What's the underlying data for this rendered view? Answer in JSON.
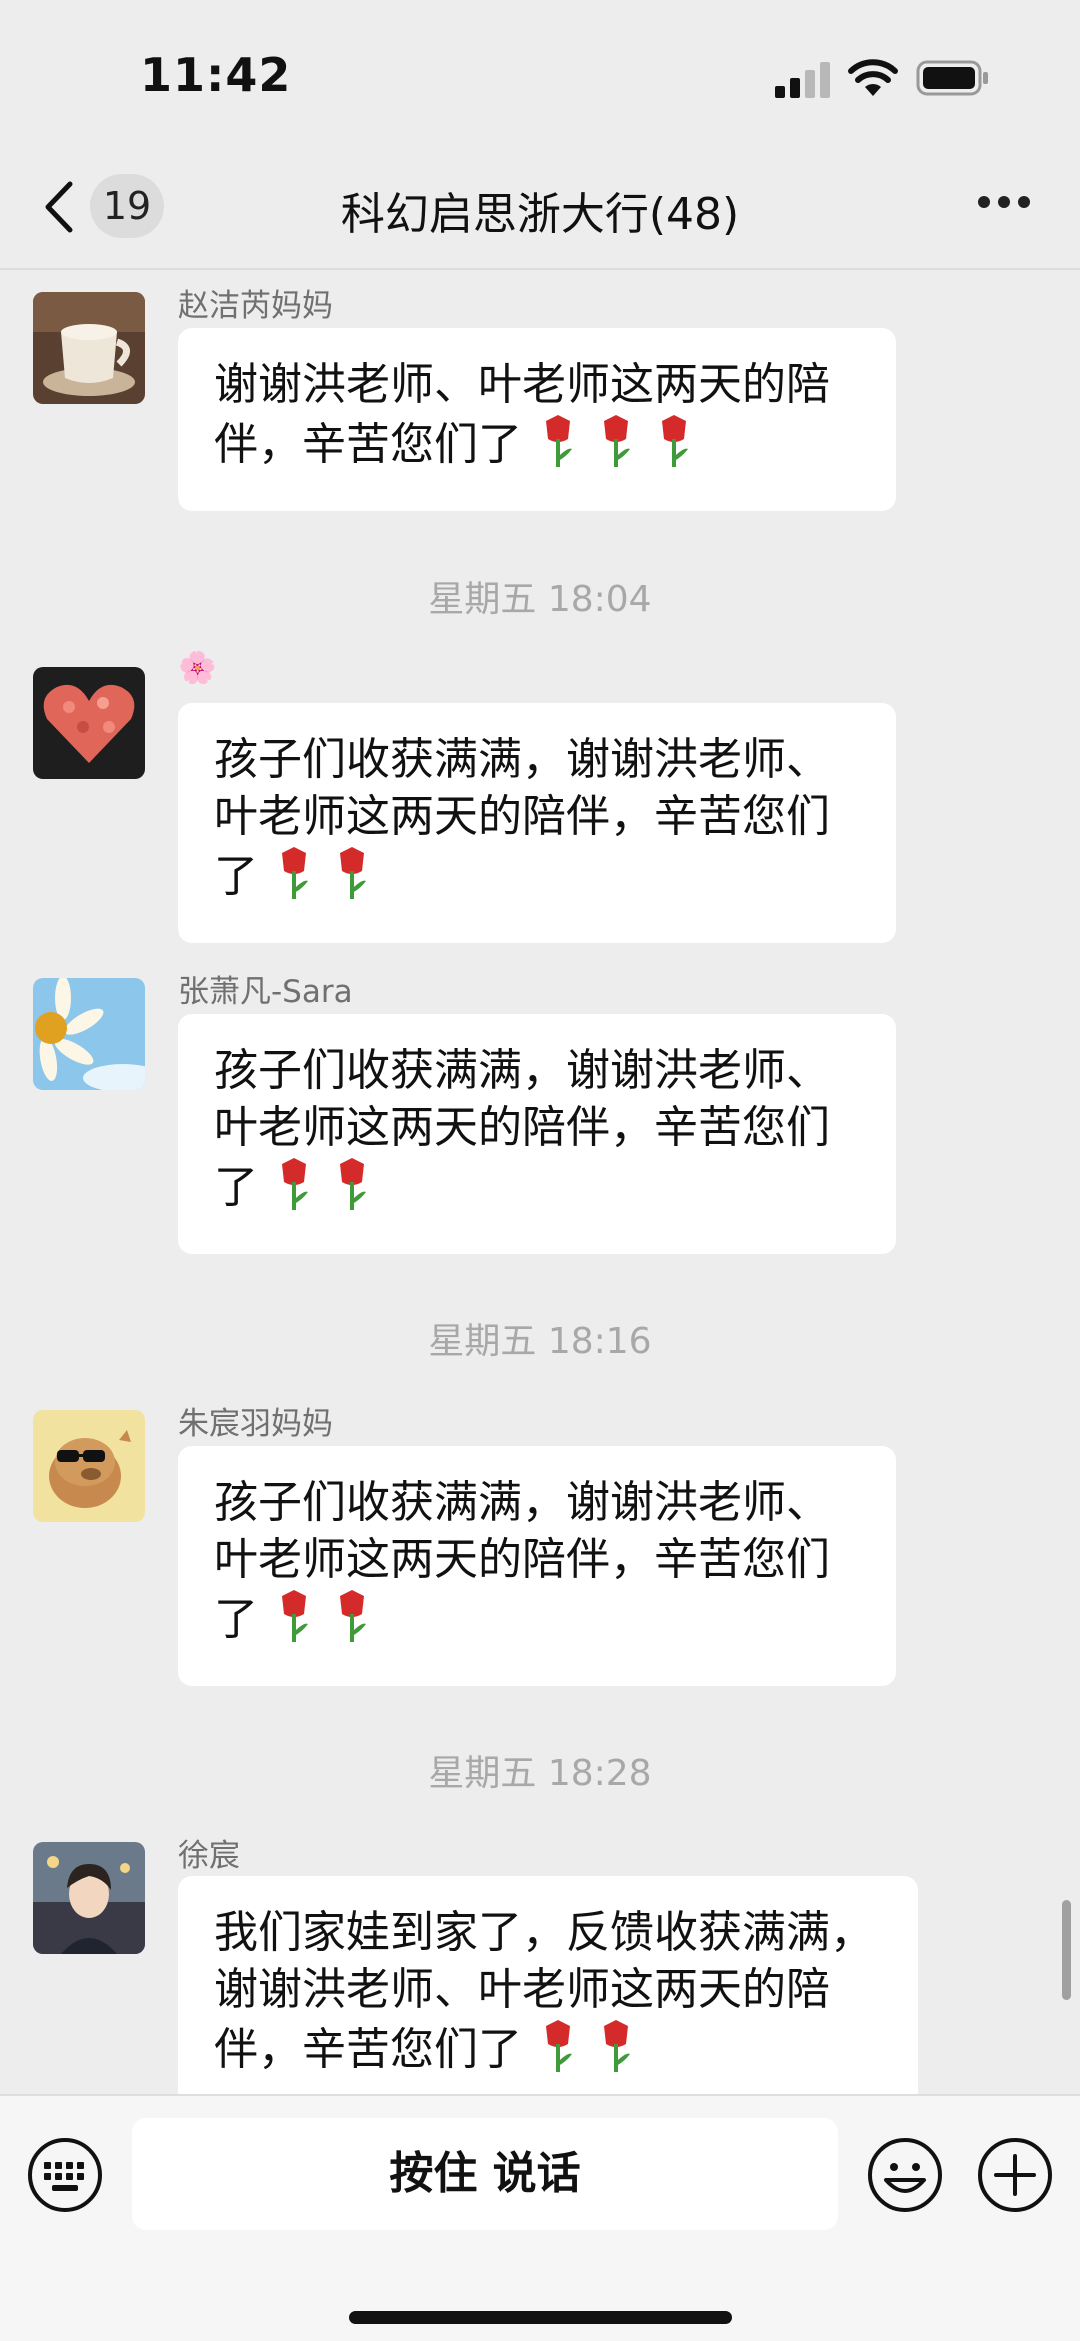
{
  "status_bar": {
    "time": "11:42"
  },
  "nav": {
    "unread_count": "19",
    "title": "科幻启思浙大行(48)"
  },
  "messages": [
    {
      "sender": "赵洁芮妈妈",
      "text": "谢谢洪老师、叶老师这两天的陪伴，辛苦您们了",
      "tulips": 3,
      "avatar": "coffee-cup-avatar"
    },
    {
      "time": "星期五 18:04"
    },
    {
      "sender": "🌸",
      "text": "孩子们收获满满，谢谢洪老师、叶老师这两天的陪伴，辛苦您们了",
      "tulips": 2,
      "avatar": "heart-petals-avatar"
    },
    {
      "sender": "张萧凡-Sara",
      "text": "孩子们收获满满，谢谢洪老师、叶老师这两天的陪伴，辛苦您们了",
      "tulips": 2,
      "avatar": "sunflower-sky-avatar"
    },
    {
      "time": "星期五 18:16"
    },
    {
      "sender": "朱宸羽妈妈",
      "text": "孩子们收获满满，谢谢洪老师、叶老师这两天的陪伴，辛苦您们了",
      "tulips": 2,
      "avatar": "capybara-sunglasses-avatar"
    },
    {
      "time": "星期五 18:28"
    },
    {
      "sender": "徐宸",
      "text": "我们家娃到家了，反馈收获满满，谢谢洪老师、叶老师这两天的陪伴，辛苦您们了",
      "tulips": 2,
      "avatar": "anime-boy-avatar"
    }
  ],
  "input_bar": {
    "voice_label": "按住 说话"
  },
  "colors": {
    "background": "#ededed",
    "bubble": "#ffffff",
    "time_text": "#a8a8a8",
    "sender_text": "#707070",
    "tulip_red": "#d42a2a",
    "stem_green": "#3f9a3a"
  },
  "icons": [
    "back-chevron-icon",
    "more-dots-icon",
    "keyboard-icon",
    "emoji-icon",
    "plus-icon",
    "tulip-icon"
  ]
}
